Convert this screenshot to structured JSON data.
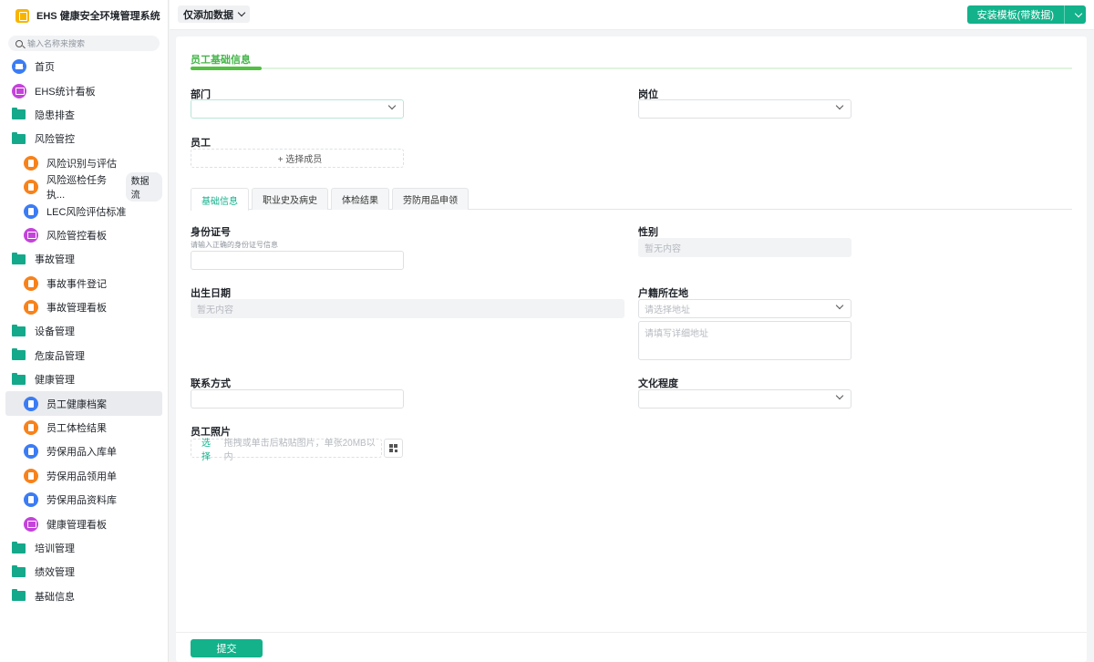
{
  "app": {
    "title": "EHS 健康安全环境管理系统",
    "search_placeholder": "输入名称来搜索"
  },
  "sidebar": {
    "items": [
      {
        "label": "首页",
        "icon": "home-icon",
        "type": "top"
      },
      {
        "label": "EHS统计看板",
        "icon": "dashboard-icon",
        "type": "top"
      },
      {
        "label": "隐患排查",
        "icon": "folder-icon",
        "type": "folder"
      },
      {
        "label": "风险管控",
        "icon": "folder-icon",
        "type": "folder"
      },
      {
        "label": "风险识别与评估",
        "icon": "form-icon",
        "type": "sub"
      },
      {
        "label": "风险巡检任务执...",
        "icon": "form-icon",
        "type": "sub",
        "badge": "数据流"
      },
      {
        "label": "LEC风险评估标准",
        "icon": "table-icon",
        "type": "sub"
      },
      {
        "label": "风险管控看板",
        "icon": "dashboard-icon",
        "type": "sub"
      },
      {
        "label": "事故管理",
        "icon": "folder-icon",
        "type": "folder"
      },
      {
        "label": "事故事件登记",
        "icon": "form-icon",
        "type": "sub"
      },
      {
        "label": "事故管理看板",
        "icon": "form-icon",
        "type": "sub"
      },
      {
        "label": "设备管理",
        "icon": "folder-icon",
        "type": "folder"
      },
      {
        "label": "危废品管理",
        "icon": "folder-icon",
        "type": "folder"
      },
      {
        "label": "健康管理",
        "icon": "folder-icon",
        "type": "folder"
      },
      {
        "label": "员工健康档案",
        "icon": "table-icon",
        "type": "sub",
        "active": true
      },
      {
        "label": "员工体检结果",
        "icon": "form-icon",
        "type": "sub"
      },
      {
        "label": "劳保用品入库单",
        "icon": "table-icon",
        "type": "sub"
      },
      {
        "label": "劳保用品领用单",
        "icon": "form-icon",
        "type": "sub"
      },
      {
        "label": "劳保用品资料库",
        "icon": "table-icon",
        "type": "sub"
      },
      {
        "label": "健康管理看板",
        "icon": "dashboard-icon",
        "type": "sub"
      },
      {
        "label": "培训管理",
        "icon": "folder-icon",
        "type": "folder"
      },
      {
        "label": "绩效管理",
        "icon": "folder-icon",
        "type": "folder"
      },
      {
        "label": "基础信息",
        "icon": "folder-icon",
        "type": "folder"
      }
    ]
  },
  "topbar": {
    "mode": "仅添加数据",
    "install": "安装模板(带数据)"
  },
  "form": {
    "section": "员工基础信息",
    "department": {
      "label": "部门"
    },
    "position": {
      "label": "岗位"
    },
    "employee": {
      "label": "员工",
      "button": "+ 选择成员"
    },
    "tabs": [
      "基础信息",
      "职业史及病史",
      "体检结果",
      "劳防用品申领"
    ],
    "id_number": {
      "label": "身份证号",
      "hint": "请输入正确的身份证号信息"
    },
    "gender": {
      "label": "性别",
      "value": "暂无内容"
    },
    "birth": {
      "label": "出生日期",
      "value": "暂无内容"
    },
    "household": {
      "label": "户籍所在地",
      "placeholder": "请选择地址",
      "detail_placeholder": "请填写详细地址"
    },
    "contact": {
      "label": "联系方式"
    },
    "education": {
      "label": "文化程度"
    },
    "photo": {
      "label": "员工照片",
      "pick": "选择",
      "hint": "拖拽或单击后粘贴图片，单张20MB以内"
    },
    "submit": "提交"
  },
  "colors": {
    "accent": "#13b28b",
    "section": "#52c041"
  }
}
